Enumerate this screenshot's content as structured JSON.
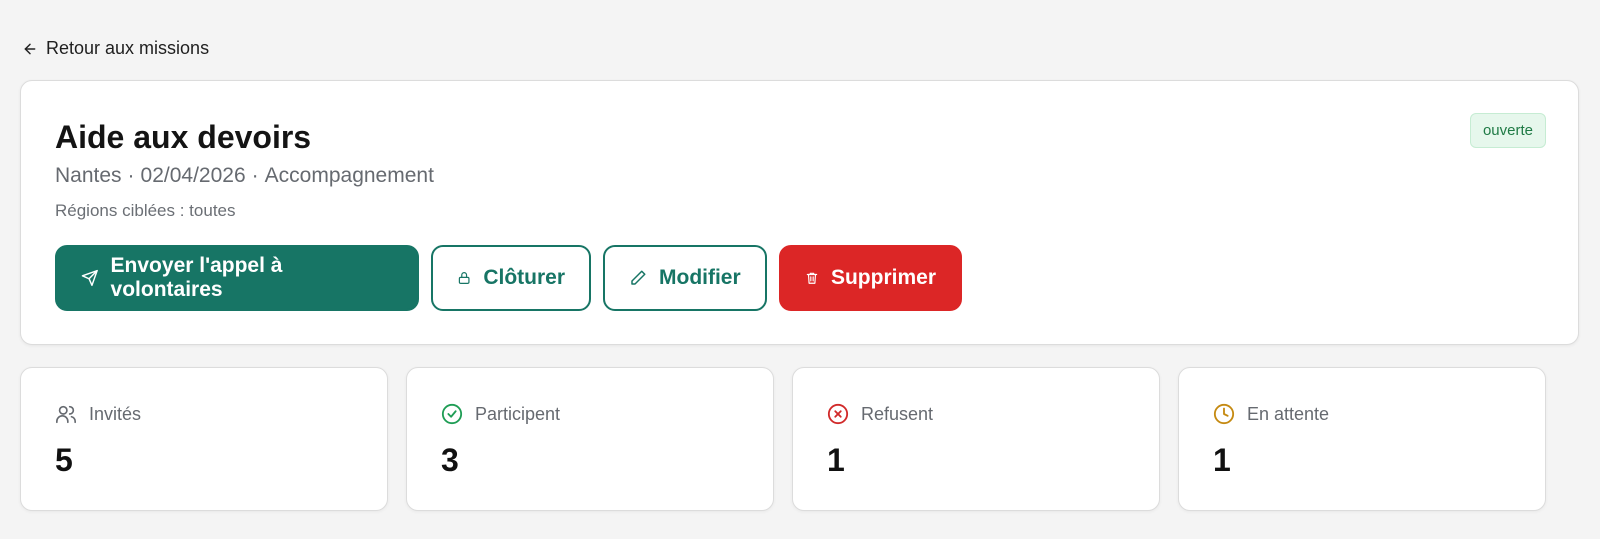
{
  "nav": {
    "back_label": "Retour aux missions"
  },
  "mission": {
    "title": "Aide aux devoirs",
    "city": "Nantes",
    "date": "02/04/2026",
    "category": "Accompagnement",
    "regions": "Régions ciblées : toutes",
    "status": "ouverte"
  },
  "actions": {
    "send_label": "Envoyer l'appel à volontaires",
    "close_label": "Clôturer",
    "edit_label": "Modifier",
    "delete_label": "Supprimer"
  },
  "stats": [
    {
      "label": "Invités",
      "value": "5",
      "icon": "users-icon",
      "color": "#666a70"
    },
    {
      "label": "Participent",
      "value": "3",
      "icon": "check-circle-icon",
      "color": "#1f9d55"
    },
    {
      "label": "Refusent",
      "value": "1",
      "icon": "x-circle-icon",
      "color": "#d12a2a"
    },
    {
      "label": "En attente",
      "value": "1",
      "icon": "clock-icon",
      "color": "#c58a12"
    }
  ],
  "colors": {
    "primary": "#177565",
    "danger": "#dc2626",
    "status_bg": "#e6f7ec",
    "status_text": "#1f7a45"
  }
}
